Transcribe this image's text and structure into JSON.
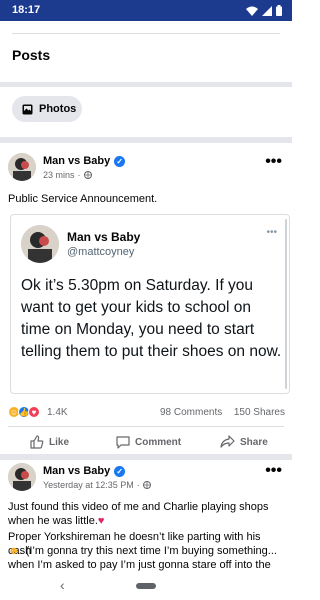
{
  "status_bar": {
    "time": "18:17",
    "icons": [
      "wifi-icon",
      "signal-icon",
      "battery-icon"
    ]
  },
  "section": {
    "title": "Posts",
    "photos_label": "Photos"
  },
  "post1": {
    "author": "Man vs Baby",
    "timestamp": "23 mins",
    "text": "Public Service Announcement.",
    "tweet": {
      "name": "Man vs Baby",
      "handle": "@mattcoyney",
      "body": "Ok it’s 5.30pm on Saturday. If you want to get your kids to school on time on Monday, you need to start telling them to put their shoes on now."
    },
    "reactions_count": "1.4K",
    "comments_count": "98 Comments",
    "shares_count": "150 Shares",
    "actions": {
      "like": "Like",
      "comment": "Comment",
      "share": "Share"
    }
  },
  "post2": {
    "author": "Man vs Baby",
    "timestamp": "Yesterday at 12:35 PM",
    "text_line1": "Just found this video of me and Charlie playing shops when he was little.",
    "text_line2": "Proper Yorkshireman he doesn’t like parting with his cash",
    "text_line3": ". (I’m gonna try this next time I’m buying something...",
    "text_line4": "when I’m asked to pay I’m just gonna stare off into the"
  },
  "colors": {
    "status_bar": "#1c3b8f",
    "verified": "#1877f2",
    "separator": "#e4e6eb",
    "secondary_text": "#65676b"
  }
}
